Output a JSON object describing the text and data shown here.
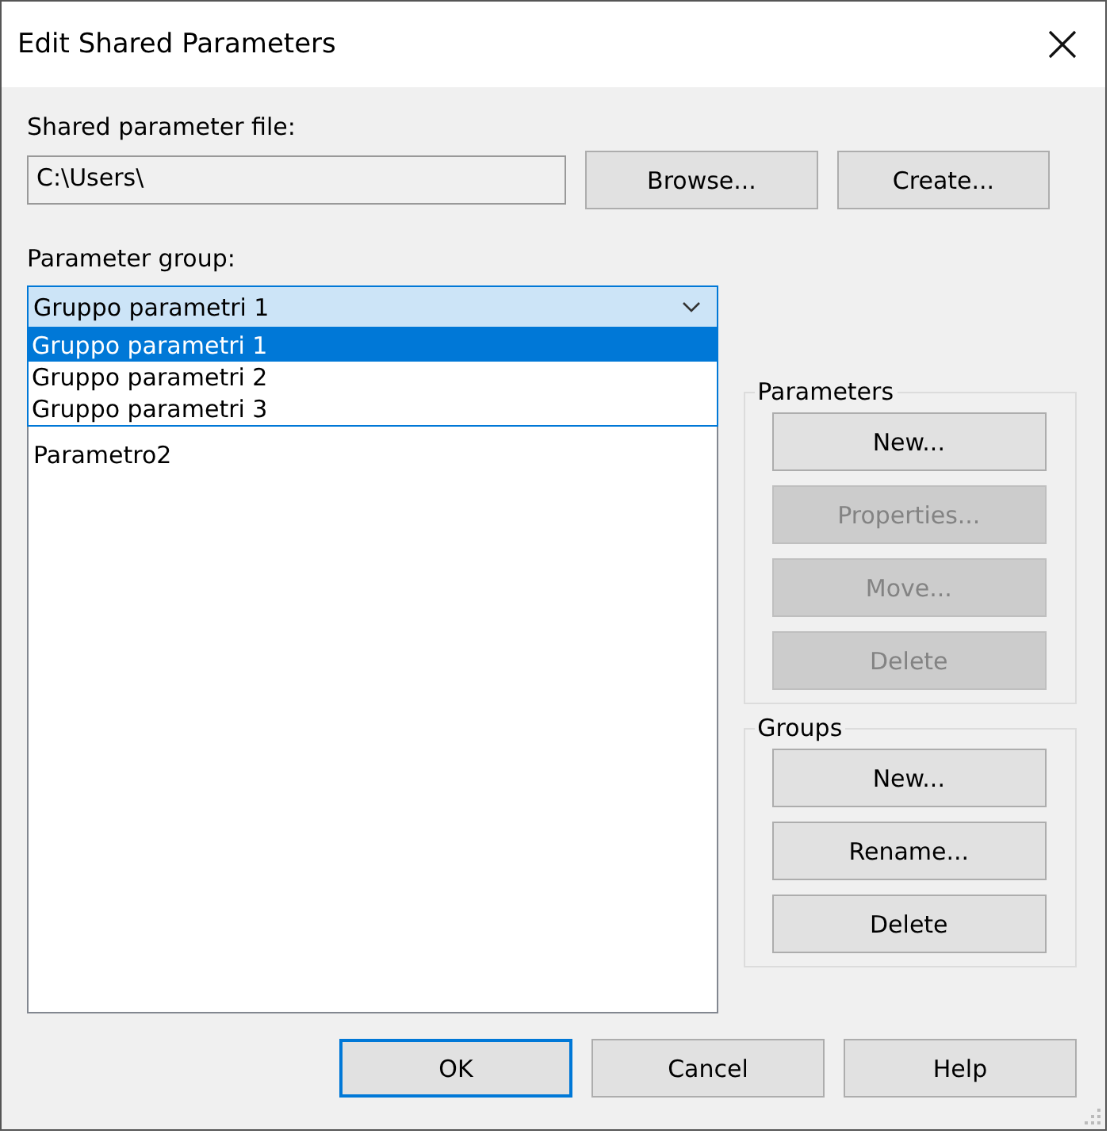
{
  "window": {
    "title": "Edit Shared Parameters"
  },
  "file": {
    "label": "Shared parameter file:",
    "value": "C:\\Users\\"
  },
  "file_buttons": [
    {
      "label": "Browse...",
      "disabled": false
    },
    {
      "label": "Create...",
      "disabled": false
    }
  ],
  "group": {
    "label": "Parameter group:",
    "value": "Gruppo parametri 1",
    "expanded": true,
    "options": [
      {
        "label": "Gruppo parametri 1",
        "selected": true
      },
      {
        "label": "Gruppo parametri 2",
        "selected": false
      },
      {
        "label": "Gruppo parametri 3",
        "selected": false
      }
    ]
  },
  "parameters_list": [
    "Parametro2"
  ],
  "boxes": [
    {
      "title": "Parameters",
      "buttons": [
        {
          "label": "New...",
          "disabled": false
        },
        {
          "label": "Properties...",
          "disabled": true
        },
        {
          "label": "Move...",
          "disabled": true
        },
        {
          "label": "Delete",
          "disabled": true
        }
      ]
    },
    {
      "title": "Groups",
      "buttons": [
        {
          "label": "New...",
          "disabled": false
        },
        {
          "label": "Rename...",
          "disabled": false
        },
        {
          "label": "Delete",
          "disabled": false
        }
      ]
    }
  ],
  "buttons": [
    {
      "label": "OK",
      "default": true
    },
    {
      "label": "Cancel",
      "default": false
    },
    {
      "label": "Help",
      "default": false
    }
  ]
}
